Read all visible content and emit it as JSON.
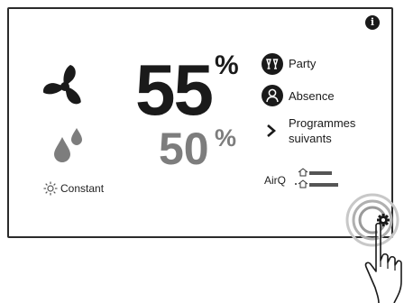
{
  "display": {
    "humidity_current": "55",
    "humidity_current_unit": "%",
    "humidity_target": "50",
    "humidity_target_unit": "%",
    "mode_label": "Constant"
  },
  "menu": {
    "party_label": "Party",
    "absence_label": "Absence",
    "next_programs_line1": "Programmes",
    "next_programs_line2": "suivants"
  },
  "air_quality": {
    "label": "AirQ",
    "indoor_level": 0.6,
    "outdoor_level": 0.75
  },
  "icons": {
    "info": "info-icon",
    "fan": "fan-icon",
    "humidity": "droplets-icon",
    "sun": "sun-icon",
    "party": "cocktail-glasses-icon",
    "absence": "person-icon",
    "chevron": "chevron-right-icon",
    "settings": "gear-icon",
    "hand": "pointing-hand-icon"
  },
  "colors": {
    "primary": "#1a1a1a",
    "secondary_value": "#7d7d7d",
    "background": "#ffffff"
  }
}
